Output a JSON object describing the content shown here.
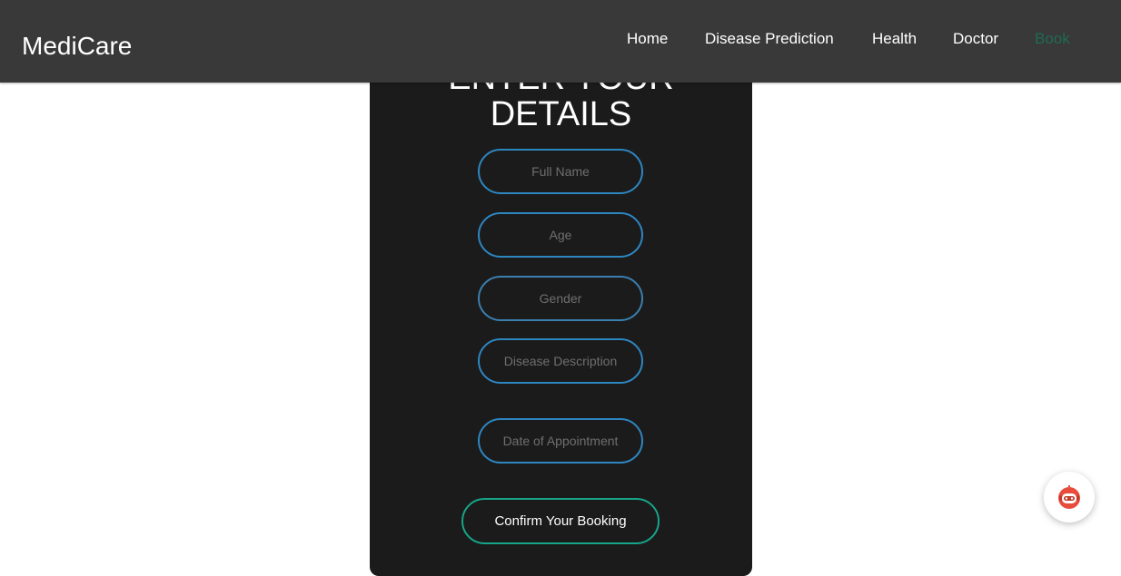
{
  "header": {
    "brand": "MediCare",
    "nav": [
      {
        "label": "Home"
      },
      {
        "label": "Disease Prediction"
      },
      {
        "label": "Health"
      },
      {
        "label": "Doctor"
      },
      {
        "label": "Book"
      }
    ],
    "active_link_color": "#1e6b54"
  },
  "form": {
    "title_line1": "ENTER YOUR",
    "title_line2": "DETAILS",
    "fields": [
      {
        "placeholder": "Full Name",
        "value": ""
      },
      {
        "placeholder": "Age",
        "value": ""
      },
      {
        "placeholder": "Gender",
        "value": ""
      },
      {
        "placeholder": "Disease Description",
        "value": ""
      },
      {
        "placeholder": "Date of Appointment",
        "value": ""
      }
    ],
    "submit_label": "Confirm Your Booking",
    "field_border_color": "#2e86c1",
    "button_border_color": "#17a589"
  },
  "chat_widget": {
    "icon": "chatbot-icon",
    "accent_color": "#e74c3c"
  }
}
